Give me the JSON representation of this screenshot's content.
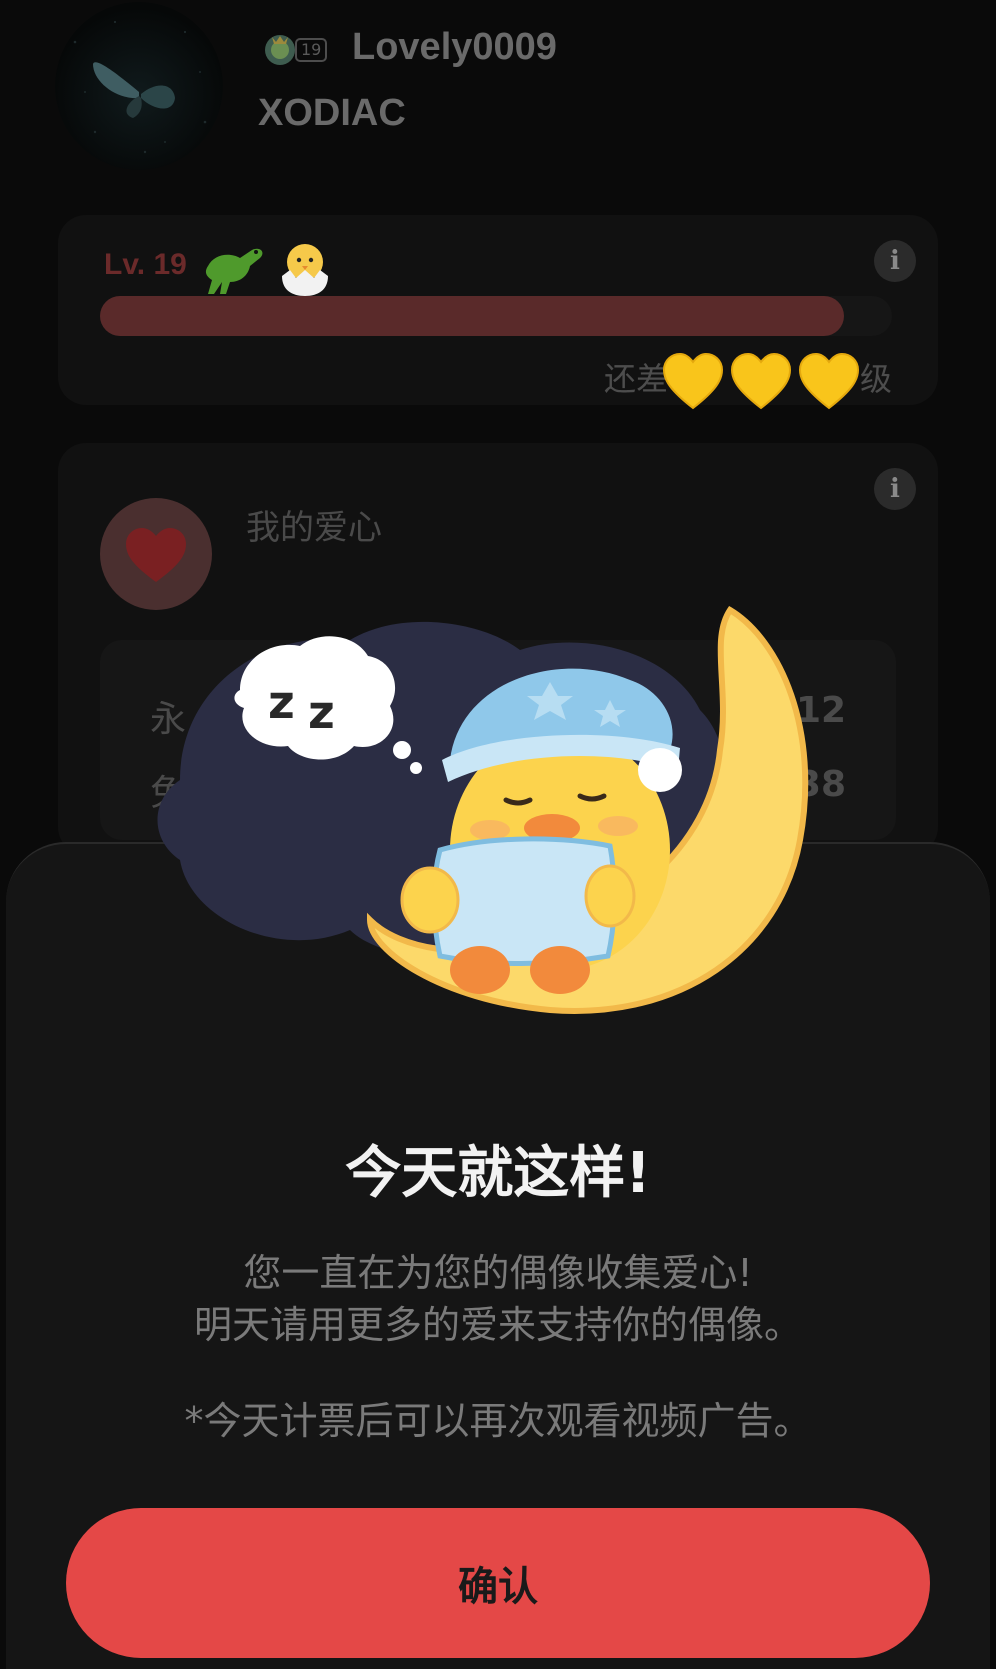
{
  "profile": {
    "username": "Lovely0009",
    "group": "XODIAC",
    "badge_level": "19"
  },
  "level_card": {
    "level": "Lv. 19",
    "progress_fraction": 0.94,
    "remaining_prefix": "还差",
    "remaining_suffix": "级",
    "info": "i"
  },
  "hearts_card": {
    "title": "我的爱心",
    "info": "i",
    "row1_label": "永",
    "row1_value": "12",
    "row2_label": "免",
    "row2_value": "38"
  },
  "dialog": {
    "title": "今天就这样!",
    "message_line1": "您一直在为您的偶像收集爱心!",
    "message_line2": "明天请用更多的爱来支持你的偶像。",
    "note": "*今天计票后可以再次观看视频广告。",
    "confirm_label": "确认"
  },
  "colors": {
    "confirm_button": "#e44847",
    "sheet_background": "#151515",
    "moon": "#fcd96a",
    "nightcap": "#8fc8ea"
  }
}
